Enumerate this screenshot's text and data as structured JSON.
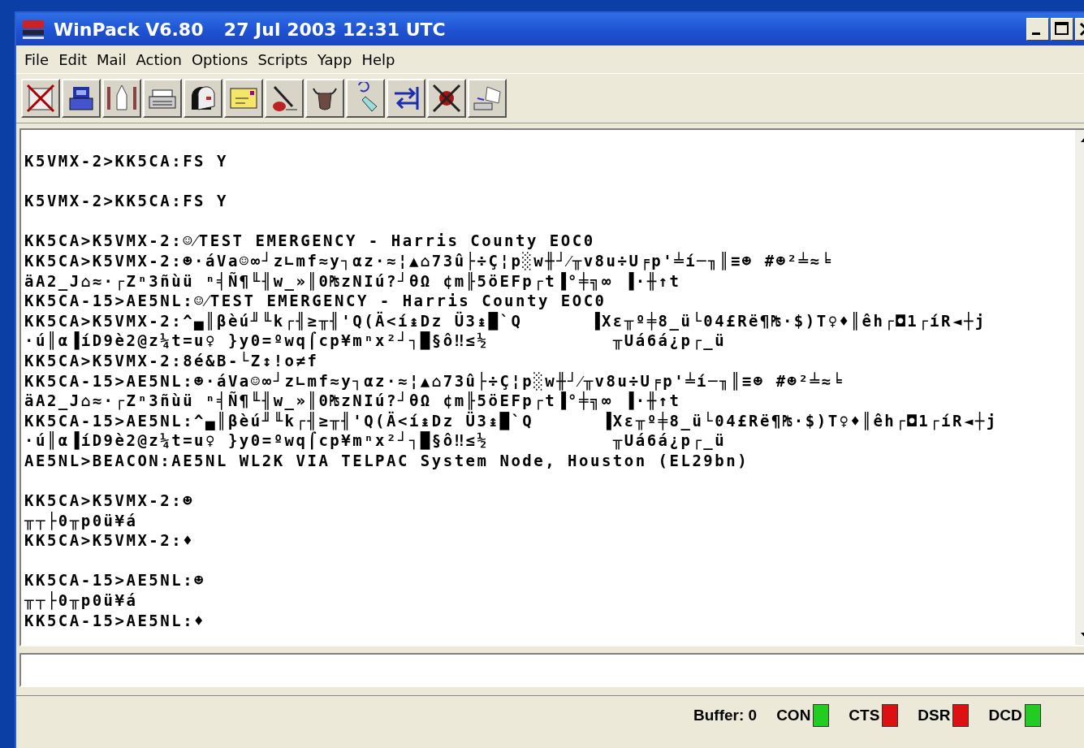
{
  "window": {
    "title": "WinPack V6.80",
    "datetime": "27 Jul 2003 12:31 UTC"
  },
  "menu": [
    "File",
    "Edit",
    "Mail",
    "Action",
    "Options",
    "Scripts",
    "Yapp",
    "Help"
  ],
  "terminal": {
    "blocks": [
      [
        "K5VMX-2>KK5CA:FS Y"
      ],
      [
        "K5VMX-2>KK5CA:FS Y"
      ],
      [
        "KK5CA>K5VMX-2:☺⁄TEST EMERGENCY - Harris County EOC0",
        "KK5CA>K5VMX-2:☻·áVa☺∞┘z∟mf≈y┐αz·≈¦▲⌂73û├÷Ç¦p░w╫┘⁄╥v8u÷U╒p'╧í─╖║≡☻ #☻²╧≈╘",
        "äA2_J⌂≈·┌Zⁿ3ñùü ⁿ╡Ñ¶╙╢w_»║0₧zNIú?┘θΩ ¢m╟5öEFp┌t▐°╪╗∞ ▐·╫↑t",
        "KK5CA-15>AE5NL:☺⁄TEST EMERGENCY - Harris County EOC0",
        "KK5CA>K5VMX-2:^▄║βèú╜╙k┌╢≥╥╢'Q(Ä<í↨Dz Ü3↨█`Q      ▐Xε╥º╪8_ü└04£Rë¶₧·$)T♀♦║êh┌◘1┌íR◄┼j",
        "·ú║α▐íD9è2@z¼t=u♀ }y0=ºwq⌠cp¥mⁿx²┘┐█§ô‼≤½           ╥Uá6á¿p┌_ü",
        "KK5CA>K5VMX-2:8é&B-└Z↕!o≠f",
        "KK5CA-15>AE5NL:☻·áVa☺∞┘z∟mf≈y┐αz·≈¦▲⌂73û├÷Ç¦p░w╫┘⁄╥v8u÷U╒p'╧í─╖║≡☻ #☻²╧≈╘",
        "äA2_J⌂≈·┌Zⁿ3ñùü ⁿ╡Ñ¶╙╢w_»║0₧zNIú?┘θΩ ¢m╟5öEFp┌t▐°╪╗∞ ▐·╫↑t",
        "KK5CA-15>AE5NL:^▄║βèú╜╙k┌╢≥╥╢'Q(Ä<í↨Dz Ü3↨█`Q      ▐Xε╥º╪8_ü└04£Rë¶₧·$)T♀♦║êh┌◘1┌íR◄┼j",
        "·ú║α▐íD9è2@z¼t=u♀ }y0=ºwq⌠cp¥mⁿx²┘┐█§ô‼≤½           ╥Uá6á¿p┌_ü",
        "AE5NL>BEACON:AE5NL WL2K VIA TELPAC System Node, Houston (EL29bn)"
      ],
      [
        "KK5CA>K5VMX-2:☻",
        "╥┬├0╥p0ü¥á",
        "KK5CA>K5VMX-2:♦"
      ],
      [
        "KK5CA-15>AE5NL:☻",
        "╥┬├0╥p0ü¥á",
        "KK5CA-15>AE5NL:♦"
      ]
    ]
  },
  "status": {
    "buffer": "Buffer: 0",
    "indicators": [
      {
        "label": "CON",
        "color": "#22cc22"
      },
      {
        "label": "CTS",
        "color": "#dd1111"
      },
      {
        "label": "DSR",
        "color": "#dd1111"
      },
      {
        "label": "DCD",
        "color": "#22cc22"
      }
    ]
  }
}
